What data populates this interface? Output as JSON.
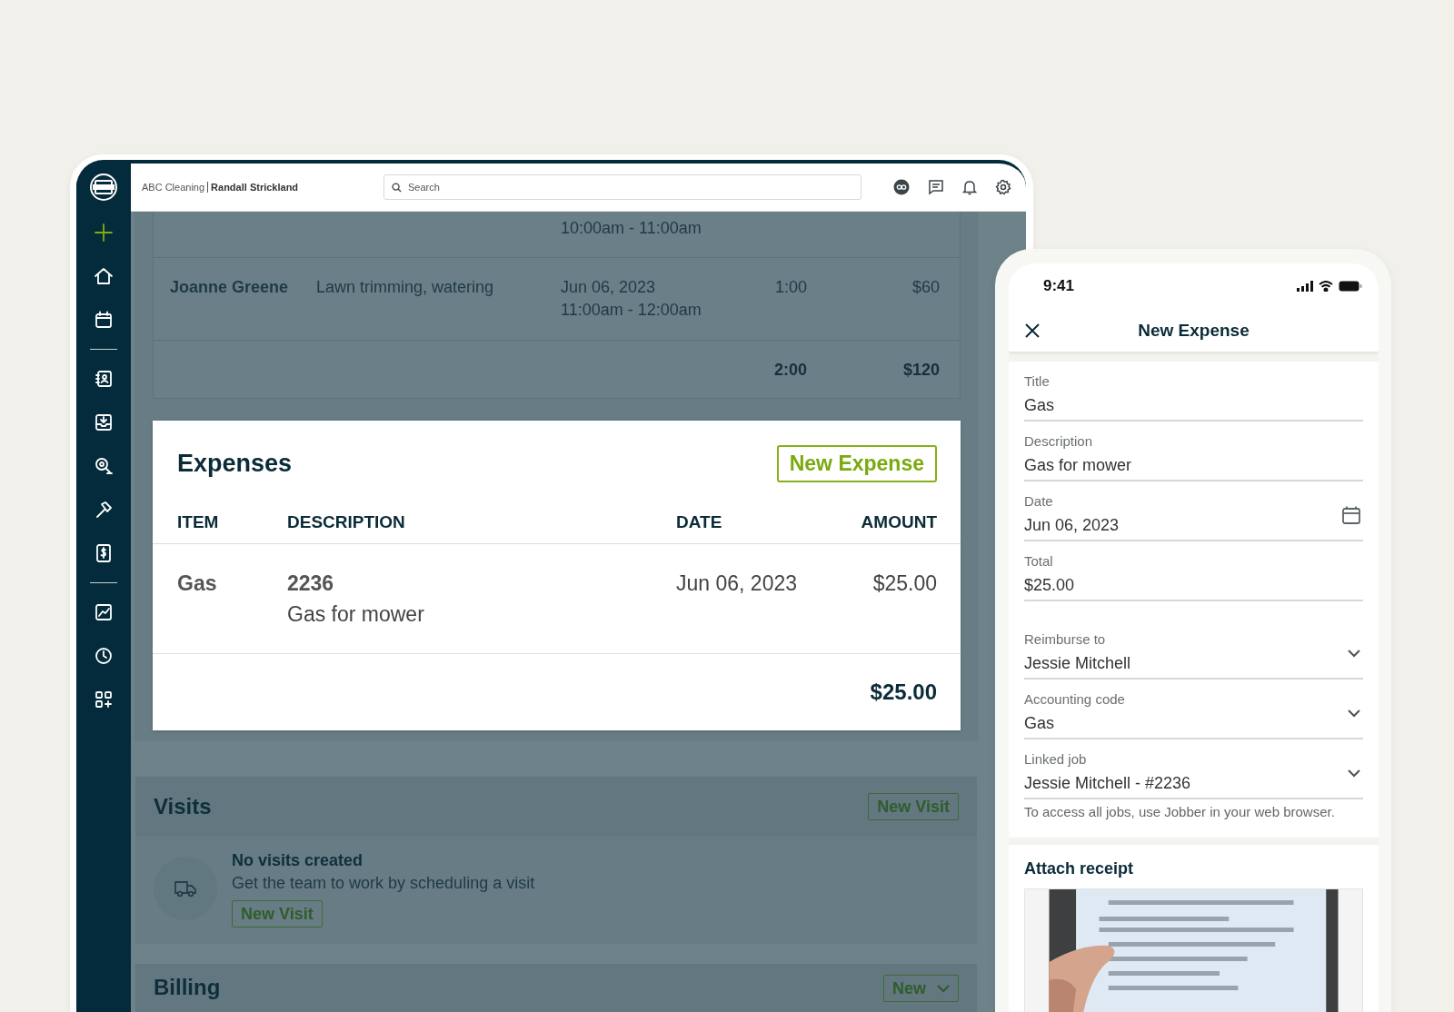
{
  "tablet": {
    "header": {
      "company": "ABC Cleaning",
      "user": "Randall Strickland",
      "search": {
        "placeholder": "Search"
      }
    },
    "timesheet": {
      "rows": [
        {
          "time": "10:00am - 11:00am"
        },
        {
          "name": "Joanne Greene",
          "description": "Lawn trimming, watering",
          "date": "Jun 06, 2023",
          "time": "11:00am - 12:00am",
          "hours": "1:00",
          "amount": "$60"
        }
      ],
      "totals": {
        "hours": "2:00",
        "amount": "$120"
      }
    },
    "expenses": {
      "title": "Expenses",
      "button": "New Expense",
      "columns": [
        "ITEM",
        "DESCRIPTION",
        "DATE",
        "AMOUNT"
      ],
      "rows": [
        {
          "item": "Gas",
          "number": "2236",
          "description": "Gas for mower",
          "date": "Jun 06, 2023",
          "amount": "$25.00"
        }
      ],
      "total": "$25.00"
    },
    "visits": {
      "title": "Visits",
      "button": "New Visit",
      "empty_title": "No visits created",
      "empty_text": "Get the team to work by scheduling a visit",
      "empty_button": "New Visit"
    },
    "billing": {
      "title": "Billing",
      "button": "New"
    }
  },
  "phone": {
    "status_time": "9:41",
    "title": "New Expense",
    "fields": [
      {
        "label": "Title",
        "value": "Gas",
        "kind": "text"
      },
      {
        "label": "Description",
        "value": "Gas for mower",
        "kind": "text"
      },
      {
        "label": "Date",
        "value": "Jun 06, 2023",
        "kind": "date"
      },
      {
        "label": "Total",
        "value": "$25.00",
        "kind": "text"
      }
    ],
    "assignment": [
      {
        "label": "Reimburse to",
        "value": "Jessie Mitchell",
        "kind": "select"
      },
      {
        "label": "Accounting code",
        "value": "Gas",
        "kind": "select"
      },
      {
        "label": "Linked job",
        "value": "Jessie Mitchell - #2236",
        "kind": "select",
        "help": "To access all jobs, use Jobber in your web browser."
      }
    ],
    "receipt": {
      "title": "Attach receipt"
    }
  }
}
